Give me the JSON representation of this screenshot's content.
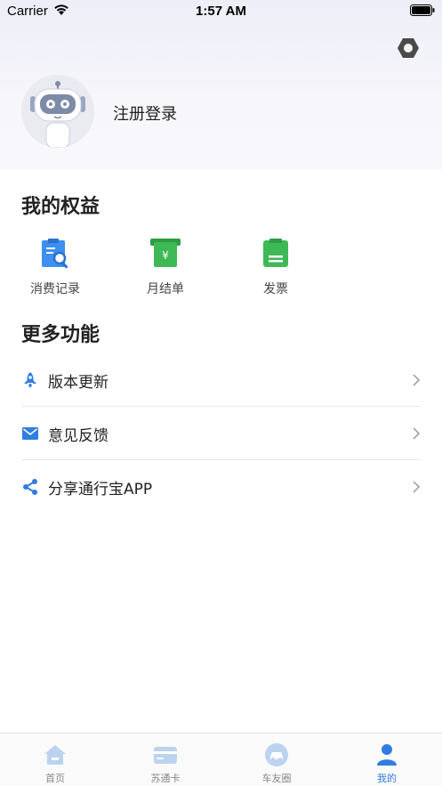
{
  "status_bar": {
    "carrier": "Carrier",
    "time": "1:57 AM"
  },
  "profile": {
    "login_label": "注册登录"
  },
  "benefits": {
    "title": "我的权益",
    "items": [
      {
        "label": "消费记录",
        "icon": "receipt-search-icon",
        "color": "#3d8ff0"
      },
      {
        "label": "月结单",
        "icon": "monthly-bill-icon",
        "color": "#3fb856"
      },
      {
        "label": "发票",
        "icon": "invoice-icon",
        "color": "#3fb856"
      }
    ]
  },
  "more": {
    "title": "更多功能",
    "items": [
      {
        "label": "版本更新",
        "icon": "rocket-icon"
      },
      {
        "label": "意见反馈",
        "icon": "mail-icon"
      },
      {
        "label": "分享通行宝APP",
        "icon": "share-icon"
      }
    ]
  },
  "tabs": [
    {
      "label": "首页",
      "icon": "home-icon",
      "active": false
    },
    {
      "label": "苏通卡",
      "icon": "card-icon",
      "active": false
    },
    {
      "label": "车友圈",
      "icon": "car-circle-icon",
      "active": false
    },
    {
      "label": "我的",
      "icon": "user-icon",
      "active": true
    }
  ],
  "colors": {
    "accent": "#2f7de1",
    "tab_inactive": "#bcd3f0",
    "green": "#3fb856"
  }
}
